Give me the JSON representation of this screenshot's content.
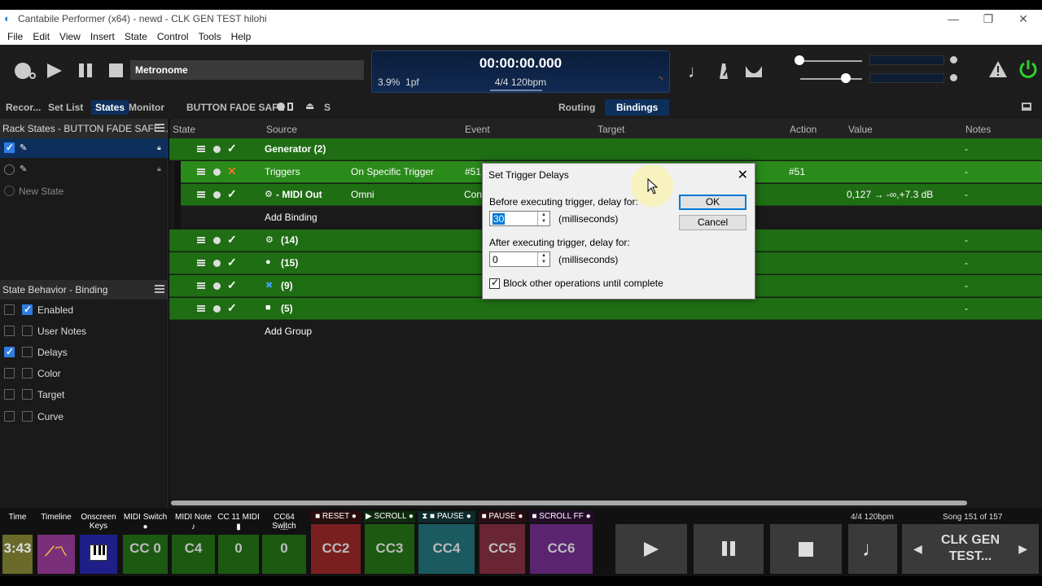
{
  "window": {
    "title": "Cantabile Performer (x64) - newd - CLK GEN TEST hilohi",
    "minimize": "—",
    "maximize": "❐",
    "close": "✕"
  },
  "menu": [
    "File",
    "Edit",
    "View",
    "Insert",
    "State",
    "Control",
    "Tools",
    "Help"
  ],
  "transport": {
    "selected": "Metronome",
    "time": "00:00:00.000",
    "load": "3.9%",
    "pf": "1pf",
    "tempo": "4/4 120bpm"
  },
  "left_tabs": [
    "Recor...",
    "Set List",
    "States",
    "Monitor"
  ],
  "rack_title": "BUTTON FADE SAFE",
  "rack_s": "S",
  "view_tabs": [
    "Routing",
    "Bindings"
  ],
  "states_panel": {
    "header": "Rack States - BUTTON FADE SAFE...",
    "new_state": "New State"
  },
  "behavior_panel": {
    "header": "State Behavior - Binding",
    "items": [
      {
        "label": "Enabled",
        "checked": true
      },
      {
        "label": "User Notes",
        "checked": false
      },
      {
        "label": "Delays",
        "checked": false
      },
      {
        "label": "Color",
        "checked": false
      },
      {
        "label": "Target",
        "checked": false
      },
      {
        "label": "Curve",
        "checked": false
      }
    ]
  },
  "columns": [
    "State",
    "Source",
    "Event",
    "Target",
    "Action",
    "Value",
    "Notes"
  ],
  "rows": [
    {
      "source": "Generator (2)",
      "notes": "-"
    },
    {
      "source": "Triggers",
      "event": "On Specific Trigger",
      "ev2": "#51",
      "action": "#51",
      "notes": "-"
    },
    {
      "source": "- MIDI Out",
      "event": "Omni",
      "ev2": "Con",
      "value": "0,127 → -∞,+7.3 dB",
      "notes": "-"
    },
    {
      "source": "Add Binding"
    },
    {
      "source": "(14)",
      "notes": "-"
    },
    {
      "source": "(15)",
      "notes": "-"
    },
    {
      "source": "(9)",
      "notes": "-"
    },
    {
      "source": "(5)",
      "notes": "-"
    },
    {
      "source": "Add Group"
    }
  ],
  "dialog": {
    "title": "Set Trigger Delays",
    "before_label": "Before executing trigger, delay for:",
    "before_value": "30",
    "after_label": "After executing trigger, delay for:",
    "after_value": "0",
    "unit": "(milliseconds)",
    "block_label": "Block other operations until complete",
    "ok": "OK",
    "cancel": "Cancel"
  },
  "bottom": {
    "cells": [
      {
        "label": "Time",
        "value": "3:43",
        "color": "#8a8a2e"
      },
      {
        "label": "Timeline",
        "value": "",
        "color": "#8a3a8a"
      },
      {
        "label": "Onscreen Keys",
        "value": "",
        "color": "#2a2a9a"
      },
      {
        "label": "MIDI Switch",
        "value": "CC 0",
        "color": "#1f6e14"
      },
      {
        "label": "MIDI Note",
        "value": "C4",
        "color": "#1f6e14"
      },
      {
        "label": "CC 11 MIDI",
        "value": "0",
        "color": "#1f6e14"
      },
      {
        "label": "CC64 Switch",
        "value": "0",
        "color": "#1f6e14"
      },
      {
        "label": "RESET",
        "value": "CC2",
        "color": "#8a1f1f"
      },
      {
        "label": "SCROLL",
        "value": "CC3",
        "color": "#1f6e14"
      },
      {
        "label": "PAUSE",
        "value": "CC4",
        "color": "#1d6b70"
      },
      {
        "label": "PAUSE",
        "value": "CC5",
        "color": "#7a2a3a"
      },
      {
        "label": "SCROLL FF",
        "value": "CC6",
        "color": "#6a2a7a"
      }
    ],
    "tempo": "4/4 120bpm",
    "song": "Song 151 of 157",
    "song_name": "CLK GEN TEST..."
  }
}
